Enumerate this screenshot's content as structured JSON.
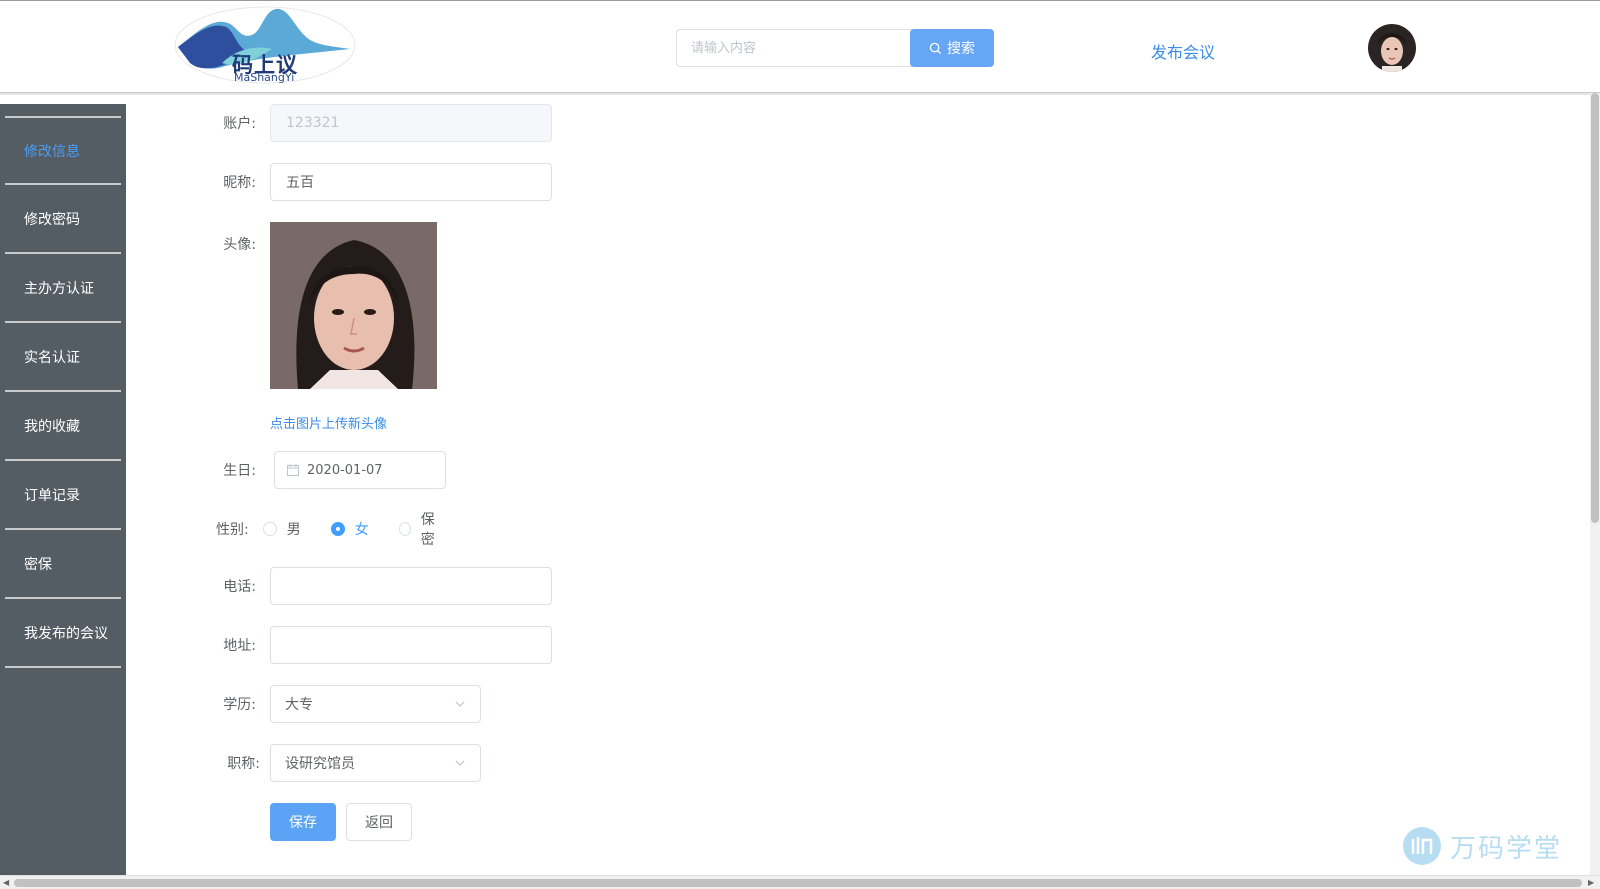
{
  "header": {
    "logo_text": "码上议",
    "logo_sub": "MaShangYi",
    "search_placeholder": "请输入内容",
    "search_label": "搜索",
    "publish_label": "发布会议"
  },
  "sidebar": {
    "items": [
      {
        "label": "修改信息",
        "active": true
      },
      {
        "label": "修改密码"
      },
      {
        "label": "主办方认证"
      },
      {
        "label": "实名认证"
      },
      {
        "label": "我的收藏"
      },
      {
        "label": "订单记录"
      },
      {
        "label": "密保"
      },
      {
        "label": "我发布的会议"
      }
    ]
  },
  "form": {
    "account": {
      "label": "账户:",
      "value": "123321"
    },
    "nickname": {
      "label": "昵称:",
      "value": "五百"
    },
    "avatar": {
      "label": "头像:",
      "upload_text": "点击图片上传新头像"
    },
    "birthday": {
      "label": "生日:",
      "value": "2020-01-07"
    },
    "gender": {
      "label": "性别:",
      "options": [
        "男",
        "女",
        "保密"
      ],
      "selected": "女"
    },
    "phone": {
      "label": "电话:",
      "value": ""
    },
    "address": {
      "label": "地址:",
      "value": ""
    },
    "education": {
      "label": "学历:",
      "value": "大专"
    },
    "title": {
      "label": "职称:",
      "value": "设研究馆员"
    },
    "save_label": "保存",
    "back_label": "返回"
  },
  "watermark": {
    "text": "万码学堂"
  },
  "colors": {
    "primary": "#409eff",
    "sidebar_bg": "#545c64",
    "link": "#3a8ee6"
  }
}
